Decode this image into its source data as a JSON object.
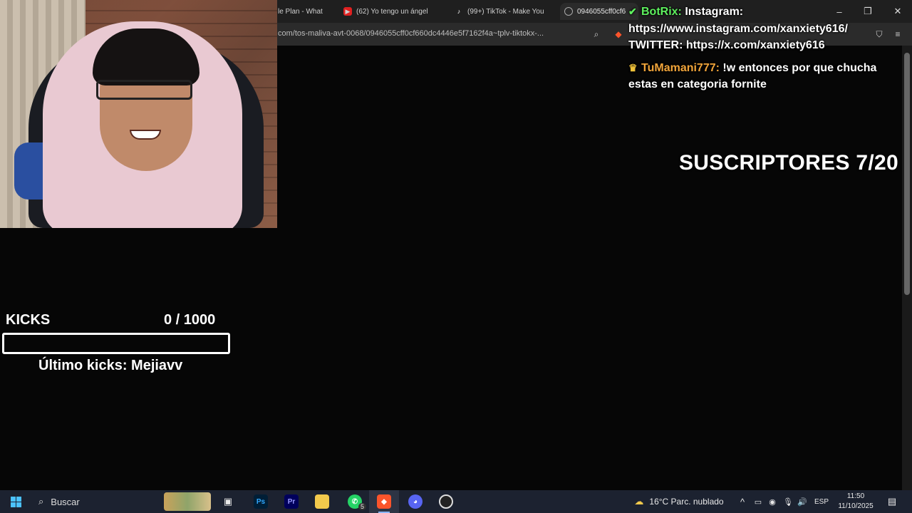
{
  "browser": {
    "tabs": [
      {
        "label": "le Plan - What",
        "icon": "globe-icon"
      },
      {
        "label": "(62) Yo tengo un ángel",
        "icon": "youtube-icon"
      },
      {
        "label": "(99+) TikTok - Make You",
        "icon": "tiktok-icon"
      },
      {
        "label": "0946055cff0cf6",
        "icon": "globe-icon",
        "active": true
      }
    ],
    "url": "com/tos-maliva-avt-0068/0946055cff0cf660dc4446e5f7162f4a~tplv-tiktokx-..."
  },
  "chat": {
    "messages": [
      {
        "user": "BotRix:",
        "text": " Instagram: https://www.instagram.com/xanxiety616/ TWITTER: https://x.com/xanxiety616",
        "badge": "verified-icon",
        "color": "#5ef05e"
      },
      {
        "user": "TuMamani777:",
        "text": " !w entonces por que chucha estas en categoria fornite",
        "badge": "crown-icon",
        "color": "#f0a43a"
      }
    ]
  },
  "overlay": {
    "subs": "SUSCRIPTORES 7/20",
    "kicks_label": "KICKS",
    "kicks_count": "0  / 1000",
    "kicks_progress": 0,
    "last_kick": "Último kicks: Mejiavv"
  },
  "taskbar": {
    "search_placeholder": "Buscar",
    "weather": "16°C  Parc. nublado",
    "lang": "ESP",
    "time": "11:50",
    "date": "11/10/2025",
    "whatsapp_badge": "5"
  }
}
